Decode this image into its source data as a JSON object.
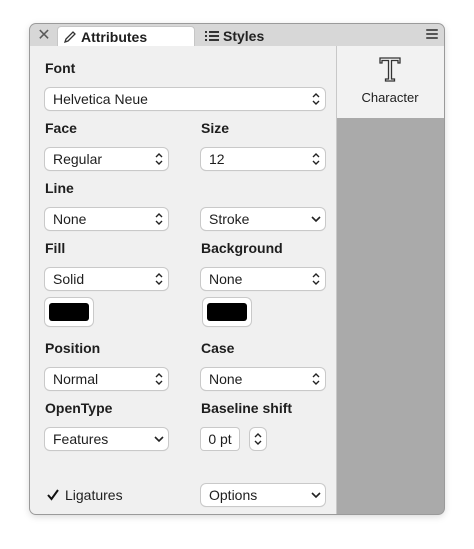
{
  "tabs": {
    "close_icon": "close-icon",
    "attributes": {
      "label": "Attributes",
      "icon": "pencil-icon"
    },
    "styles": {
      "label": "Styles",
      "icon": "list-icon"
    }
  },
  "sidebar": {
    "character_label": "Character",
    "icon": "text-t-icon"
  },
  "inspector": {
    "font_label": "Font",
    "font_value": "Helvetica Neue",
    "face_label": "Face",
    "face_value": "Regular",
    "size_label": "Size",
    "size_value": "12",
    "line_label": "Line",
    "line_value": "None",
    "stroke_value": "Stroke",
    "fill_label": "Fill",
    "fill_value": "Solid",
    "fill_color": "#000000",
    "background_label": "Background",
    "background_value": "None",
    "background_color": "#000000",
    "position_label": "Position",
    "position_value": "Normal",
    "case_label": "Case",
    "case_value": "None",
    "opentype_label": "OpenType",
    "opentype_value": "Features",
    "baseline_label": "Baseline shift",
    "baseline_value": "0 pt",
    "ligatures_label": "Ligatures",
    "ligatures_checked": true,
    "options_value": "Options"
  }
}
